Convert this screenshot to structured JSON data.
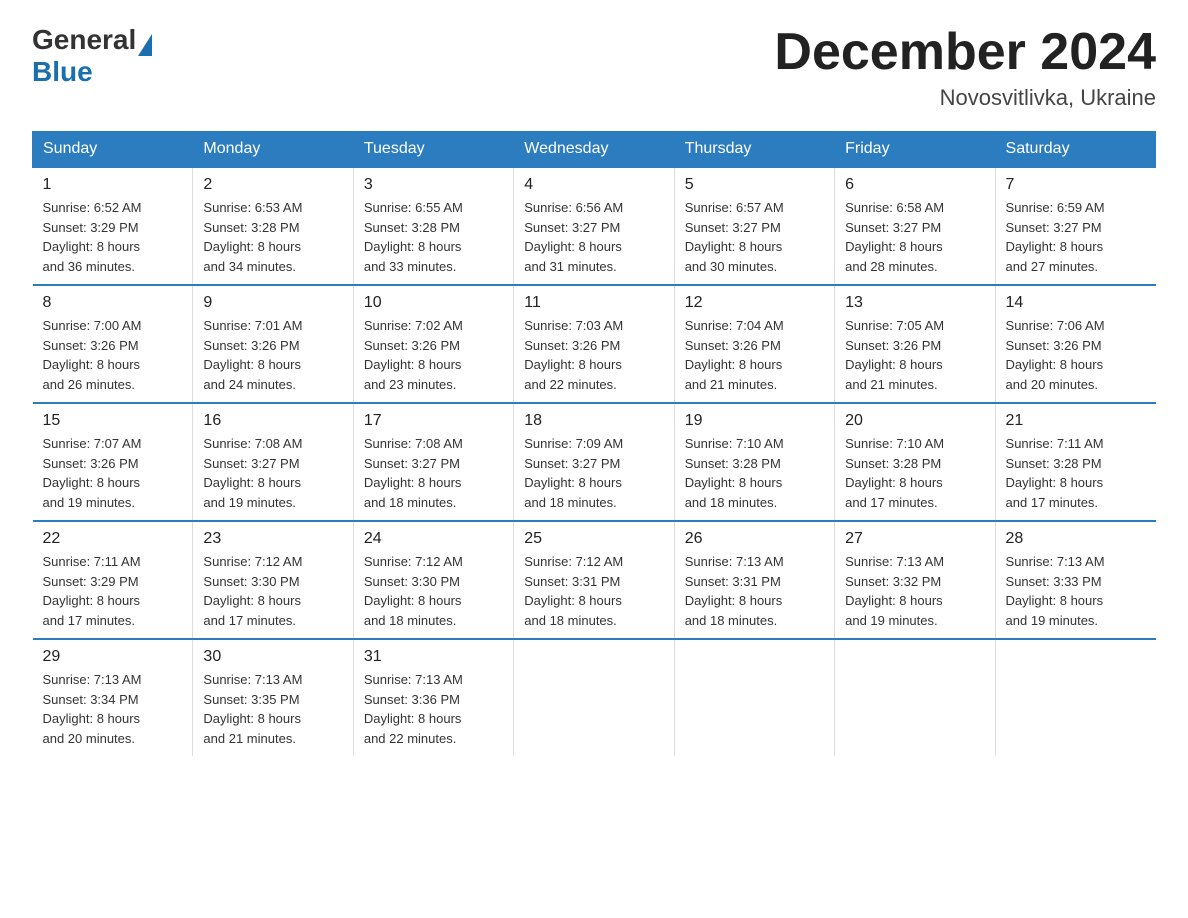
{
  "logo": {
    "general": "General",
    "blue": "Blue"
  },
  "title": "December 2024",
  "subtitle": "Novosvitlivka, Ukraine",
  "days_of_week": [
    "Sunday",
    "Monday",
    "Tuesday",
    "Wednesday",
    "Thursday",
    "Friday",
    "Saturday"
  ],
  "weeks": [
    [
      {
        "day": "1",
        "sunrise": "6:52 AM",
        "sunset": "3:29 PM",
        "daylight": "8 hours and 36 minutes."
      },
      {
        "day": "2",
        "sunrise": "6:53 AM",
        "sunset": "3:28 PM",
        "daylight": "8 hours and 34 minutes."
      },
      {
        "day": "3",
        "sunrise": "6:55 AM",
        "sunset": "3:28 PM",
        "daylight": "8 hours and 33 minutes."
      },
      {
        "day": "4",
        "sunrise": "6:56 AM",
        "sunset": "3:27 PM",
        "daylight": "8 hours and 31 minutes."
      },
      {
        "day": "5",
        "sunrise": "6:57 AM",
        "sunset": "3:27 PM",
        "daylight": "8 hours and 30 minutes."
      },
      {
        "day": "6",
        "sunrise": "6:58 AM",
        "sunset": "3:27 PM",
        "daylight": "8 hours and 28 minutes."
      },
      {
        "day": "7",
        "sunrise": "6:59 AM",
        "sunset": "3:27 PM",
        "daylight": "8 hours and 27 minutes."
      }
    ],
    [
      {
        "day": "8",
        "sunrise": "7:00 AM",
        "sunset": "3:26 PM",
        "daylight": "8 hours and 26 minutes."
      },
      {
        "day": "9",
        "sunrise": "7:01 AM",
        "sunset": "3:26 PM",
        "daylight": "8 hours and 24 minutes."
      },
      {
        "day": "10",
        "sunrise": "7:02 AM",
        "sunset": "3:26 PM",
        "daylight": "8 hours and 23 minutes."
      },
      {
        "day": "11",
        "sunrise": "7:03 AM",
        "sunset": "3:26 PM",
        "daylight": "8 hours and 22 minutes."
      },
      {
        "day": "12",
        "sunrise": "7:04 AM",
        "sunset": "3:26 PM",
        "daylight": "8 hours and 21 minutes."
      },
      {
        "day": "13",
        "sunrise": "7:05 AM",
        "sunset": "3:26 PM",
        "daylight": "8 hours and 21 minutes."
      },
      {
        "day": "14",
        "sunrise": "7:06 AM",
        "sunset": "3:26 PM",
        "daylight": "8 hours and 20 minutes."
      }
    ],
    [
      {
        "day": "15",
        "sunrise": "7:07 AM",
        "sunset": "3:26 PM",
        "daylight": "8 hours and 19 minutes."
      },
      {
        "day": "16",
        "sunrise": "7:08 AM",
        "sunset": "3:27 PM",
        "daylight": "8 hours and 19 minutes."
      },
      {
        "day": "17",
        "sunrise": "7:08 AM",
        "sunset": "3:27 PM",
        "daylight": "8 hours and 18 minutes."
      },
      {
        "day": "18",
        "sunrise": "7:09 AM",
        "sunset": "3:27 PM",
        "daylight": "8 hours and 18 minutes."
      },
      {
        "day": "19",
        "sunrise": "7:10 AM",
        "sunset": "3:28 PM",
        "daylight": "8 hours and 18 minutes."
      },
      {
        "day": "20",
        "sunrise": "7:10 AM",
        "sunset": "3:28 PM",
        "daylight": "8 hours and 17 minutes."
      },
      {
        "day": "21",
        "sunrise": "7:11 AM",
        "sunset": "3:28 PM",
        "daylight": "8 hours and 17 minutes."
      }
    ],
    [
      {
        "day": "22",
        "sunrise": "7:11 AM",
        "sunset": "3:29 PM",
        "daylight": "8 hours and 17 minutes."
      },
      {
        "day": "23",
        "sunrise": "7:12 AM",
        "sunset": "3:30 PM",
        "daylight": "8 hours and 17 minutes."
      },
      {
        "day": "24",
        "sunrise": "7:12 AM",
        "sunset": "3:30 PM",
        "daylight": "8 hours and 18 minutes."
      },
      {
        "day": "25",
        "sunrise": "7:12 AM",
        "sunset": "3:31 PM",
        "daylight": "8 hours and 18 minutes."
      },
      {
        "day": "26",
        "sunrise": "7:13 AM",
        "sunset": "3:31 PM",
        "daylight": "8 hours and 18 minutes."
      },
      {
        "day": "27",
        "sunrise": "7:13 AM",
        "sunset": "3:32 PM",
        "daylight": "8 hours and 19 minutes."
      },
      {
        "day": "28",
        "sunrise": "7:13 AM",
        "sunset": "3:33 PM",
        "daylight": "8 hours and 19 minutes."
      }
    ],
    [
      {
        "day": "29",
        "sunrise": "7:13 AM",
        "sunset": "3:34 PM",
        "daylight": "8 hours and 20 minutes."
      },
      {
        "day": "30",
        "sunrise": "7:13 AM",
        "sunset": "3:35 PM",
        "daylight": "8 hours and 21 minutes."
      },
      {
        "day": "31",
        "sunrise": "7:13 AM",
        "sunset": "3:36 PM",
        "daylight": "8 hours and 22 minutes."
      },
      null,
      null,
      null,
      null
    ]
  ],
  "labels": {
    "sunrise": "Sunrise:",
    "sunset": "Sunset:",
    "daylight": "Daylight:"
  }
}
